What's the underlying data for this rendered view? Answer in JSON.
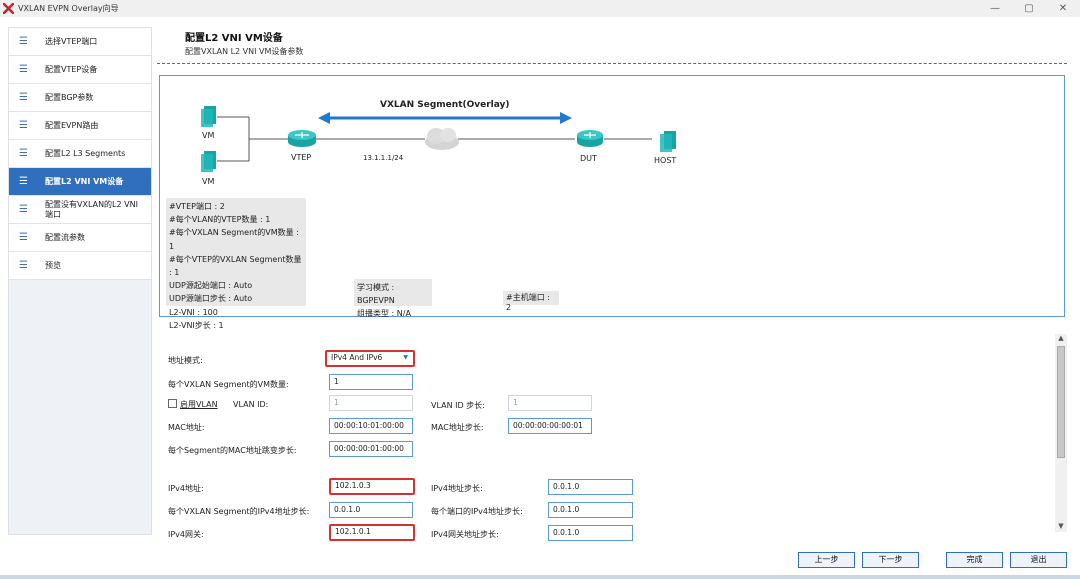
{
  "window": {
    "title": "VXLAN EVPN Overlay向导",
    "controls": [
      "—",
      "▢",
      "✕"
    ]
  },
  "sidebar": {
    "items": [
      {
        "label": "选择VTEP端口",
        "icon": "list-icon"
      },
      {
        "label": "配置VTEP设备",
        "icon": "list-icon"
      },
      {
        "label": "配置BGP参数",
        "icon": "list-icon"
      },
      {
        "label": "配置EVPN路由",
        "icon": "list-icon"
      },
      {
        "label": "配置L2 L3 Segments",
        "icon": "list-icon"
      },
      {
        "label": "配置L2 VNI VM设备",
        "icon": "list-icon",
        "active": true
      },
      {
        "label": "配置没有VXLAN的L2 VNI端口",
        "icon": "list-icon"
      },
      {
        "label": "配置流参数",
        "icon": "list-icon"
      },
      {
        "label": "预览",
        "icon": "list-icon"
      }
    ]
  },
  "page": {
    "title": "配置L2 VNI VM设备",
    "subtitle": "配置VXLAN L2 VNI VM设备参数"
  },
  "diagram": {
    "segment_label": "VXLAN Segment(Overlay)",
    "vm1": "VM",
    "vm2": "VM",
    "vtep": "VTEP",
    "link_ip": "13.1.1.1/24",
    "dut": "DUT",
    "host": "HOST",
    "info_lines": [
      "#VTEP端口 : 2",
      "#每个VLAN的VTEP数量 : 1",
      "#每个VXLAN Segment的VM数量 : 1",
      "#每个VTEP的VXLAN Segment数量 : 1",
      "UDP源起始端口 : Auto",
      "UDP源端口步长 : Auto",
      "L2-VNI : 100",
      "L2-VNI步长 : 1"
    ],
    "learn_mode": "学习模式 : BGPEVPN",
    "multicast_type": "组播类型 : N/A",
    "host_ports": "#主机端口 : 2"
  },
  "form": {
    "address_mode_label": "地址模式:",
    "address_mode_value": "IPv4 And IPv6",
    "vm_count_label": "每个VXLAN Segment的VM数量:",
    "vm_count_value": "1",
    "enable_vlan_label": "启用VLAN",
    "vlan_id_label": "VLAN ID:",
    "vlan_id_value": "1",
    "vlan_step_label": "VLAN ID 步长:",
    "vlan_step_value": "1",
    "mac_label": "MAC地址:",
    "mac_value": "00:00:10:01:00:00",
    "mac_step_label": "MAC地址步长:",
    "mac_step_value": "00:00:00:00:00:01",
    "seg_mac_step_label": "每个Segment的MAC地址跳变步长:",
    "seg_mac_step_value": "00:00:00:01:00:00",
    "ipv4_label": "IPv4地址:",
    "ipv4_value": "102.1.0.3",
    "ipv4_step_label": "IPv4地址步长:",
    "ipv4_step_value": "0.0.1.0",
    "seg_ipv4_step_label": "每个VXLAN Segment的IPv4地址步长:",
    "seg_ipv4_step_value": "0.0.1.0",
    "port_ipv4_step_label": "每个端口的IPv4地址步长:",
    "port_ipv4_step_value": "0.0.1.0",
    "gw_label": "IPv4网关:",
    "gw_value": "102.1.0.1",
    "gw_step_label": "IPv4网关地址步长:",
    "gw_step_value": "0.0.1.0"
  },
  "buttons": {
    "prev": "上一步",
    "next": "下一步",
    "finish": "完成",
    "exit": "退出"
  },
  "colors": {
    "accent": "#2f6fbd",
    "highlight": "#d63131",
    "arrow": "#1f78d1"
  }
}
